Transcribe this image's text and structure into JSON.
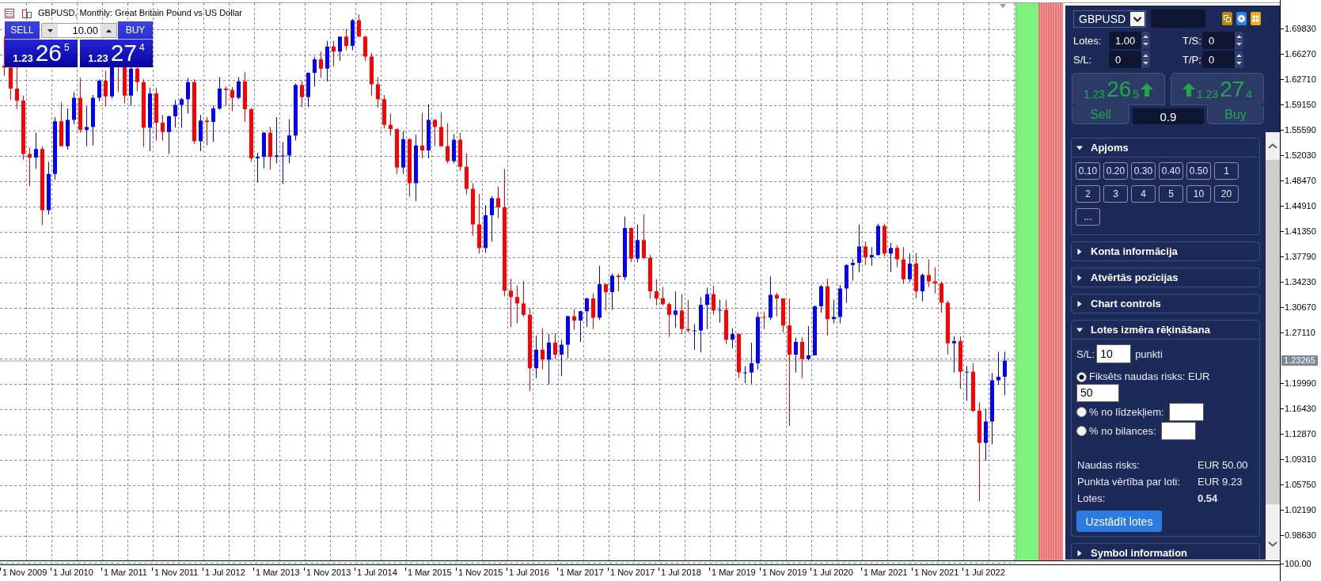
{
  "chart_header": {
    "title": "GBPUSD, Monthly: Great Britain Pound vs US Dollar"
  },
  "one_click": {
    "sell": {
      "label": "SELL",
      "prefix": "1.23",
      "pips": "26",
      "fraction": "5"
    },
    "volume": "10.00",
    "buy": {
      "label": "BUY",
      "prefix": "1.23",
      "pips": "27",
      "fraction": "4"
    }
  },
  "panel": {
    "symbol": "GBPUSD",
    "fields": [
      {
        "label": "Lotes:",
        "value": "1.00"
      },
      {
        "label": "T/S:",
        "value": "0"
      },
      {
        "label": "S/L:",
        "value": "0"
      },
      {
        "label": "T/P:",
        "value": "0"
      }
    ],
    "quotes": [
      {
        "kind": "sell",
        "label": "Sell",
        "prefix": "1.23",
        "pips": "26",
        "fraction": "5"
      },
      {
        "kind": "buy",
        "label": "Buy",
        "prefix": "1.23",
        "pips": "27",
        "fraction": "4"
      }
    ],
    "spread": "0.9",
    "sections": [
      {
        "kind": "volumes",
        "title": "Apjoms",
        "expanded": true,
        "buttons": [
          "0.10",
          "0.20",
          "0.30",
          "0.40",
          "0.50",
          "1",
          "2",
          "3",
          "4",
          "5",
          "10",
          "20",
          "..."
        ]
      },
      {
        "kind": "plain",
        "title": "Konta informācija",
        "expanded": false
      },
      {
        "kind": "plain",
        "title": "Atvērtās pozīcijas",
        "expanded": false
      },
      {
        "kind": "plain",
        "title": "Chart controls",
        "expanded": false
      },
      {
        "kind": "calculator",
        "title": "Lotes izmēra rēķināšana",
        "expanded": true,
        "sl": {
          "label": "S/L:",
          "value": "10",
          "unit": "punkti"
        },
        "options": [
          {
            "label": "Fiksēts naudas risks: EUR",
            "selected": true,
            "value": "50"
          },
          {
            "label": "% no līdzekļiem:",
            "selected": false
          },
          {
            "label": "% no bilances:",
            "selected": false
          }
        ],
        "results": [
          {
            "kind": "plain",
            "label": "Naudas risks:",
            "value": "EUR 50.00"
          },
          {
            "kind": "plain",
            "label": "Punkta vērtība par loti:",
            "value": "EUR 9.23"
          },
          {
            "kind": "total",
            "label": "Lotes:",
            "value": "0.54"
          }
        ],
        "button": "Uzstādīt lotes"
      },
      {
        "kind": "plain",
        "title": "Symbol information",
        "expanded": false
      }
    ]
  },
  "price_axis": {
    "labels": [
      "1.69830",
      "1.66270",
      "1.62710",
      "1.59150",
      "1.55590",
      "1.52030",
      "1.48470",
      "1.44910",
      "1.41350",
      "1.37790",
      "1.34230",
      "1.30670",
      "1.27110",
      "1.19990",
      "1.16430",
      "1.12870",
      "1.09310",
      "1.05750",
      "1.02190",
      "0.98630"
    ],
    "current": "1.23265",
    "indicator_label": "100.00"
  },
  "time_axis": {
    "labels": [
      "1 Nov 2009",
      "1 Jul 2010",
      "1 Mar 2011",
      "1 Nov 2011",
      "1 Jul 2012",
      "1 Mar 2013",
      "1 Nov 2013",
      "1 Jul 2014",
      "1 Mar 2015",
      "1 Nov 2015",
      "1 Jul 2016",
      "1 Mar 2017",
      "1 Nov 2017",
      "1 Jul 2018",
      "1 Mar 2019",
      "1 Nov 2019",
      "1 Jul 2020",
      "1 Mar 2021",
      "1 Nov 2021",
      "1 Jul 2022"
    ]
  }
}
